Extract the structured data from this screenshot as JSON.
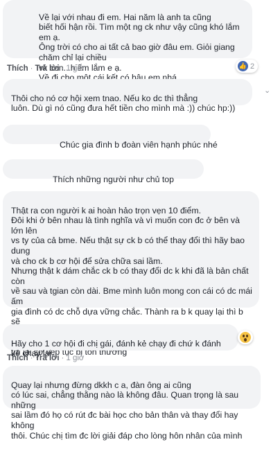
{
  "actions": {
    "like": "Thích",
    "reply": "Trả lời",
    "dot": "·",
    "time": "1 giờ"
  },
  "comments": [
    {
      "text": "Về lại với nhau đi em. Hai năm là anh ta cũng\nbiết hối hận rồi. Tìm một ng ck như vậy cũng khó lắm em ạ.\nÔng trời có cho ai tất cả bao giờ đâu em. Giỏi giang chăm chỉ lại chiều\nvk con...hiếm lắm e ạ.\nVề đi cho một cái kết có hậu em nhá.",
      "reaction": "like",
      "reaction_count": "2"
    },
    {
      "text": "Thôi cho nó cơ hội xem tnao. Nếu ko dc thì       thẳng\nluôn. Dù gì nó cũng đưa hết tiền cho mình mà :)) chúc hp:))"
    },
    {
      "text": "Chúc gia đình b đoàn viên hạnh phúc nhé"
    },
    {
      "text": "Thích những người như chủ top"
    },
    {
      "text": "Thật ra con người k ai hoàn hảo trọn vẹn 10 điểm.\nĐôi khi ở bên nhau là tình nghĩa và vì muốn con đc ở bên và lớn lên\nvs ty của cả bme. Nếu thật sự ck b có thể thay đổi thì hãy bao dung\nvà cho ck b cơ hội để sửa chữa sai lầm.\nNhưng thật k dám chắc ck b có thay đổi dc k khi đã là bản chất còn\nvề sau và tgian còn dài. Bme mình luôn mong con cái có dc mái ấm\ngia đình có dc chỗ dựa vững chắc. Thành ra b k quay lại thì b sẽ\ncảm thấy tiếc người khác sẽ dc hưởng ng đàn ông của b. B quay lại\nthì lại sợ tiếp tục bị tổn thương"
    },
    {
      "text": "Hãy cho 1 cơ hội đi chị gái, đánh kẻ chạy đi chứ k đánh\nkẻ chạy lại.",
      "reaction": "wow"
    },
    {
      "text": "Quay lại nhưng đừng dkkh c a, đàn ông ai cũng\ncó lúc sai, chẳng thằng nào là không đâu. Quan trọng là sau những\nsai lầm đó họ có rút đc bài học cho bản thân và thay đổi hay không\nthôi. Chúc chị tìm đc lời giải đáp cho lòng hôn nhân của mình"
    }
  ]
}
